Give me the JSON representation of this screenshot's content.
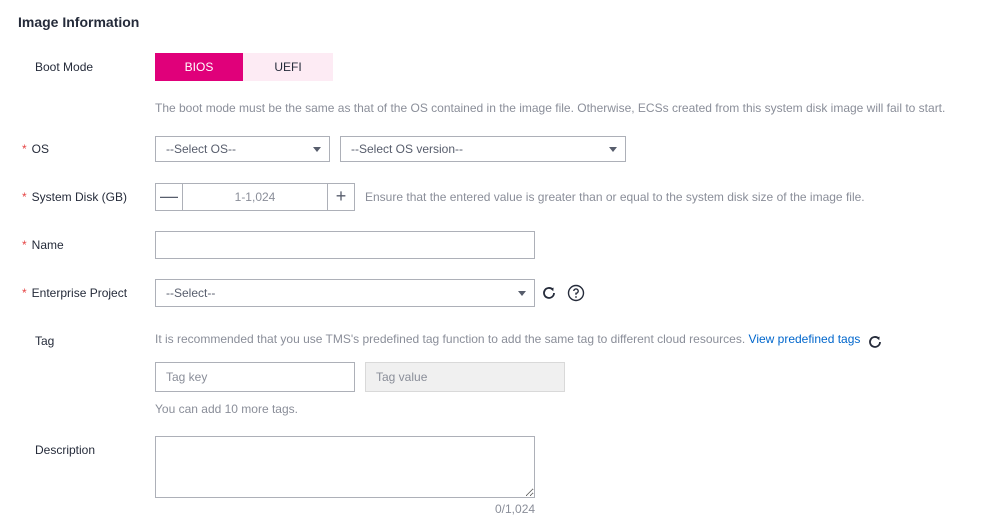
{
  "section_title": "Image Information",
  "boot_mode": {
    "label": "Boot Mode",
    "options": [
      "BIOS",
      "UEFI"
    ],
    "selected": "BIOS",
    "hint": "The boot mode must be the same as that of the OS contained in the image file. Otherwise, ECSs created from this system disk image will fail to start."
  },
  "required_mark": "*",
  "os": {
    "label": "OS",
    "os_select": "--Select OS--",
    "version_select": "--Select OS version--"
  },
  "system_disk": {
    "label": "System Disk (GB)",
    "minus": "—",
    "plus": "+",
    "placeholder": "1-1,024",
    "hint": "Ensure that the entered value is greater than or equal to the system disk size of the image file."
  },
  "name": {
    "label": "Name",
    "value": ""
  },
  "enterprise_project": {
    "label": "Enterprise Project",
    "select": "--Select--"
  },
  "tag": {
    "label": "Tag",
    "hint": "It is recommended that you use TMS's predefined tag function to add the same tag to different cloud resources.",
    "link": "View predefined tags",
    "key_placeholder": "Tag key",
    "value_placeholder": "Tag value",
    "remaining": "You can add 10 more tags."
  },
  "description": {
    "label": "Description",
    "counter": "0/1,024"
  },
  "colors": {
    "accent": "#e0007a",
    "accent_light": "#fdebf4",
    "required": "#e54545",
    "link": "#0066cc"
  }
}
